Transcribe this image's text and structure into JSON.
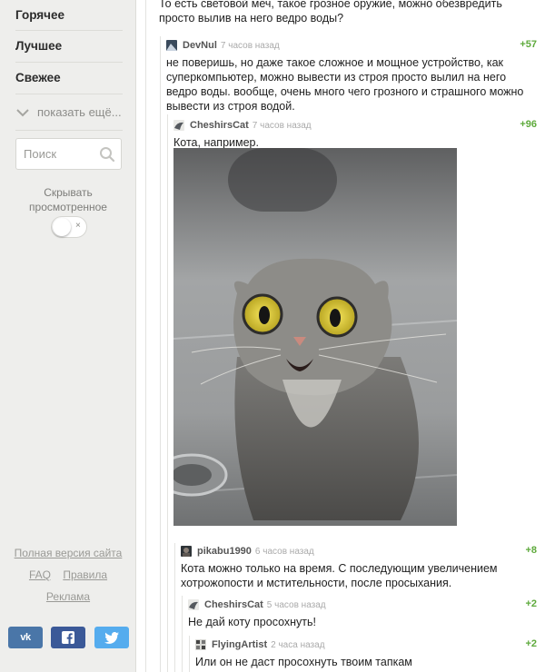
{
  "sidebar": {
    "nav": [
      "Горячее",
      "Лучшее",
      "Свежее"
    ],
    "show_more": "показать ещё...",
    "search_placeholder": "Поиск",
    "hide_viewed": "Скрывать просмотренное",
    "toggle_mark": "×",
    "footer": {
      "full_version": "Полная версия сайта",
      "faq": "FAQ",
      "rules": "Правила",
      "ads": "Реклама"
    },
    "social": [
      {
        "name": "vk",
        "label": "VK",
        "color": "#4a76a8"
      },
      {
        "name": "facebook",
        "label": "f",
        "color": "#3b5998"
      },
      {
        "name": "twitter",
        "label": "t",
        "color": "#55acee"
      }
    ]
  },
  "post": {
    "text": "То есть световой меч, такое грозное оружие, можно обезвредить просто вылив на него ведро воды?"
  },
  "comments": [
    {
      "author": "DevNul",
      "time": "7 часов назад",
      "rating": "+57",
      "text": "не поверишь, но даже такое сложное и мощное устройство, как суперкомпьютер, можно вывести из строя просто вылил на него ведро воды. вообще, очень много чего грозного и страшного можно вывести из строя водой."
    },
    {
      "author": "CheshirsCat",
      "time": "7 часов назад",
      "rating": "+96",
      "text": "Кота, например."
    },
    {
      "author": "pikabu1990",
      "time": "6 часов назад",
      "rating": "+8",
      "text": "Кота можно только на время. С последующим увеличением хотрожопости и мстительности, после просыхания."
    },
    {
      "author": "CheshirsCat",
      "time": "5 часов назад",
      "rating": "+2",
      "text": "Не дай коту просохнуть!"
    },
    {
      "author": "FlyingArtist",
      "time": "2 часа назад",
      "rating": "+2",
      "text": "Или он не даст просохнуть твоим тапкам"
    }
  ],
  "colors": {
    "rating_green": "#5eaa3c",
    "sidebar_bg": "#eeeeec"
  }
}
